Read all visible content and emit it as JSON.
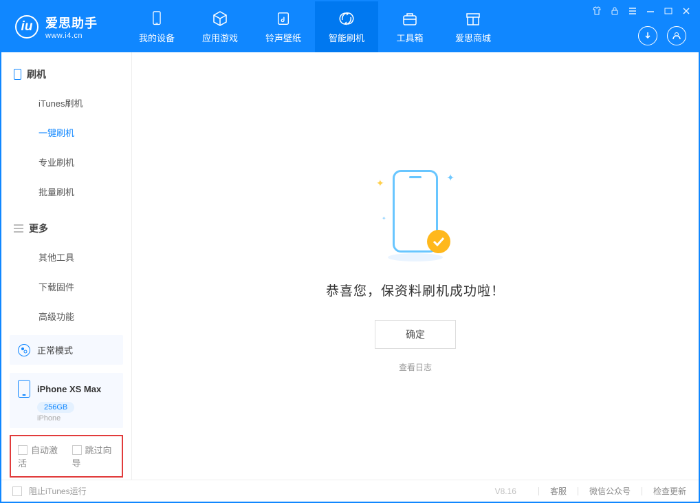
{
  "brand": {
    "name": "爱思助手",
    "url": "www.i4.cn"
  },
  "topTabs": [
    {
      "label": "我的设备",
      "icon": "device-icon"
    },
    {
      "label": "应用游戏",
      "icon": "cube-icon"
    },
    {
      "label": "铃声壁纸",
      "icon": "music-icon"
    },
    {
      "label": "智能刷机",
      "icon": "refresh-icon"
    },
    {
      "label": "工具箱",
      "icon": "toolbox-icon"
    },
    {
      "label": "爱思商城",
      "icon": "store-icon"
    }
  ],
  "sidebar": {
    "section1": {
      "title": "刷机",
      "items": [
        "iTunes刷机",
        "一键刷机",
        "专业刷机",
        "批量刷机"
      ],
      "active": 1
    },
    "section2": {
      "title": "更多",
      "items": [
        "其他工具",
        "下载固件",
        "高级功能"
      ]
    },
    "modeCard": {
      "label": "正常模式"
    },
    "deviceCard": {
      "name": "iPhone XS Max",
      "capacity": "256GB",
      "sub": "iPhone"
    },
    "bottomOptions": {
      "opt1": "自动激活",
      "opt2": "跳过向导"
    }
  },
  "content": {
    "successMsg": "恭喜您，保资料刷机成功啦！",
    "okBtn": "确定",
    "logLink": "查看日志"
  },
  "status": {
    "block_itunes": "阻止iTunes运行",
    "version": "V8.16",
    "links": [
      "客服",
      "微信公众号",
      "检查更新"
    ]
  }
}
